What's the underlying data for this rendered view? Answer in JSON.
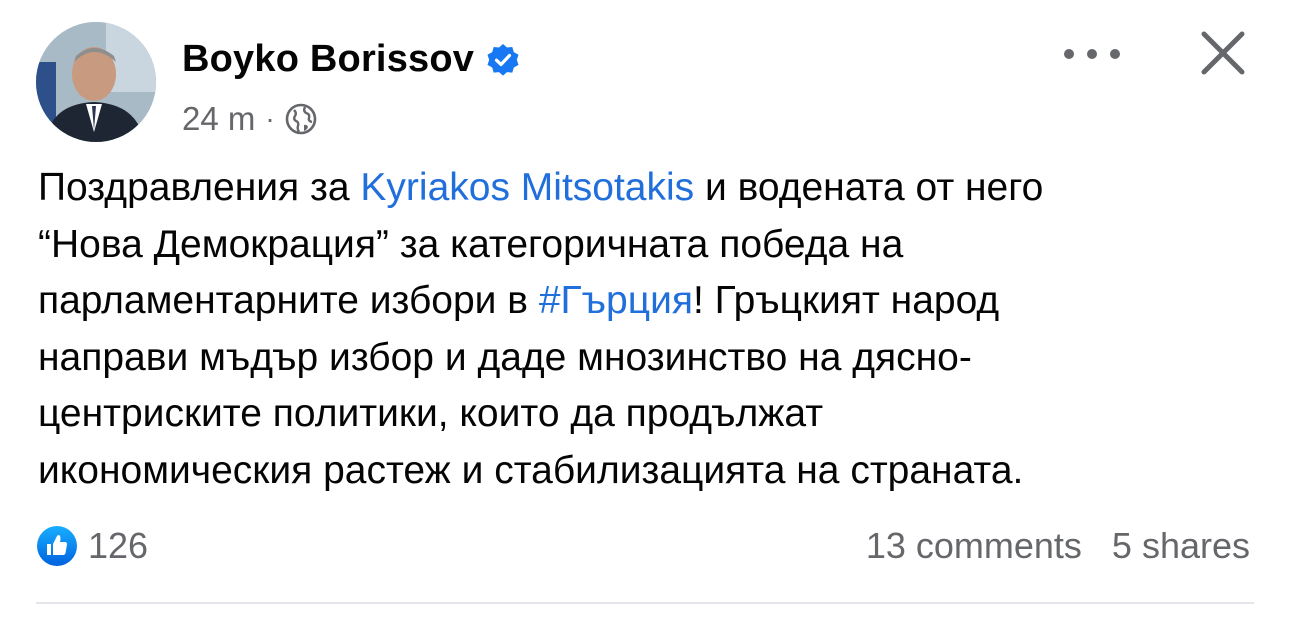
{
  "author": {
    "name": "Boyko Borissov",
    "verified": true,
    "avatar_icon": "profile-photo"
  },
  "meta": {
    "time": "24 m",
    "separator": "·",
    "privacy_icon": "globe-icon"
  },
  "actions": {
    "more_icon": "more-horizontal-icon",
    "close_icon": "close-icon"
  },
  "post": {
    "l1_a": "Поздравления за ",
    "l1_link": "Kyriakos Mitsotakis",
    "l1_b": " и водената от него",
    "l2": "“Нова Демокрация” за категоричната победа на",
    "l3_a": "парламентарните избори в ",
    "l3_link": "#Гърция",
    "l3_b": "! Гръцкият народ",
    "l4": "направи мъдър избор и даде мнозинство на дясно-",
    "l5": "центриските политики, които да продължат",
    "l6": "икономическия растеж и стабилизацията на страната."
  },
  "reactions": {
    "icon": "like-icon",
    "count": "126"
  },
  "stats": {
    "comments": "13 comments",
    "shares": "5 shares"
  },
  "colors": {
    "link": "#216fdb",
    "secondary_text": "#65676b",
    "verified": "#1877f2"
  }
}
